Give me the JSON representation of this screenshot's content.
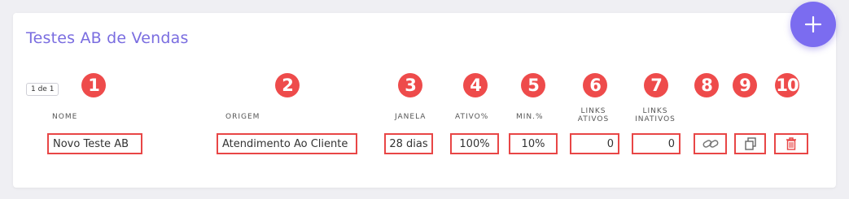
{
  "card": {
    "title": "Testes AB de Vendas",
    "pagination": "1 de 1"
  },
  "fab": {
    "icon": "plus-icon"
  },
  "columns": {
    "nome": "NOME",
    "origem": "ORIGEM",
    "janela": "JANELA",
    "ativo": "ATIVO%",
    "min": "MIN.%",
    "links_ativos_1": "LINKS",
    "links_ativos_2": "ATIVOS",
    "links_inativos_1": "LINKS",
    "links_inativos_2": "INATIVOS"
  },
  "markers": [
    "1",
    "2",
    "3",
    "4",
    "5",
    "6",
    "7",
    "8",
    "9",
    "10"
  ],
  "row": {
    "nome": "Novo Teste AB",
    "origem": "Atendimento Ao Cliente",
    "janela": "28 dias",
    "ativo": "100%",
    "min": "10%",
    "links_ativos": "0",
    "links_inativos": "0"
  },
  "actions": {
    "link_icon": "link-icon",
    "copy_icon": "copy-icon",
    "delete_icon": "trash-icon"
  },
  "colors": {
    "accent": "#7b6cf0",
    "marker": "#ee4b4b",
    "highlight_border": "#e84646"
  }
}
